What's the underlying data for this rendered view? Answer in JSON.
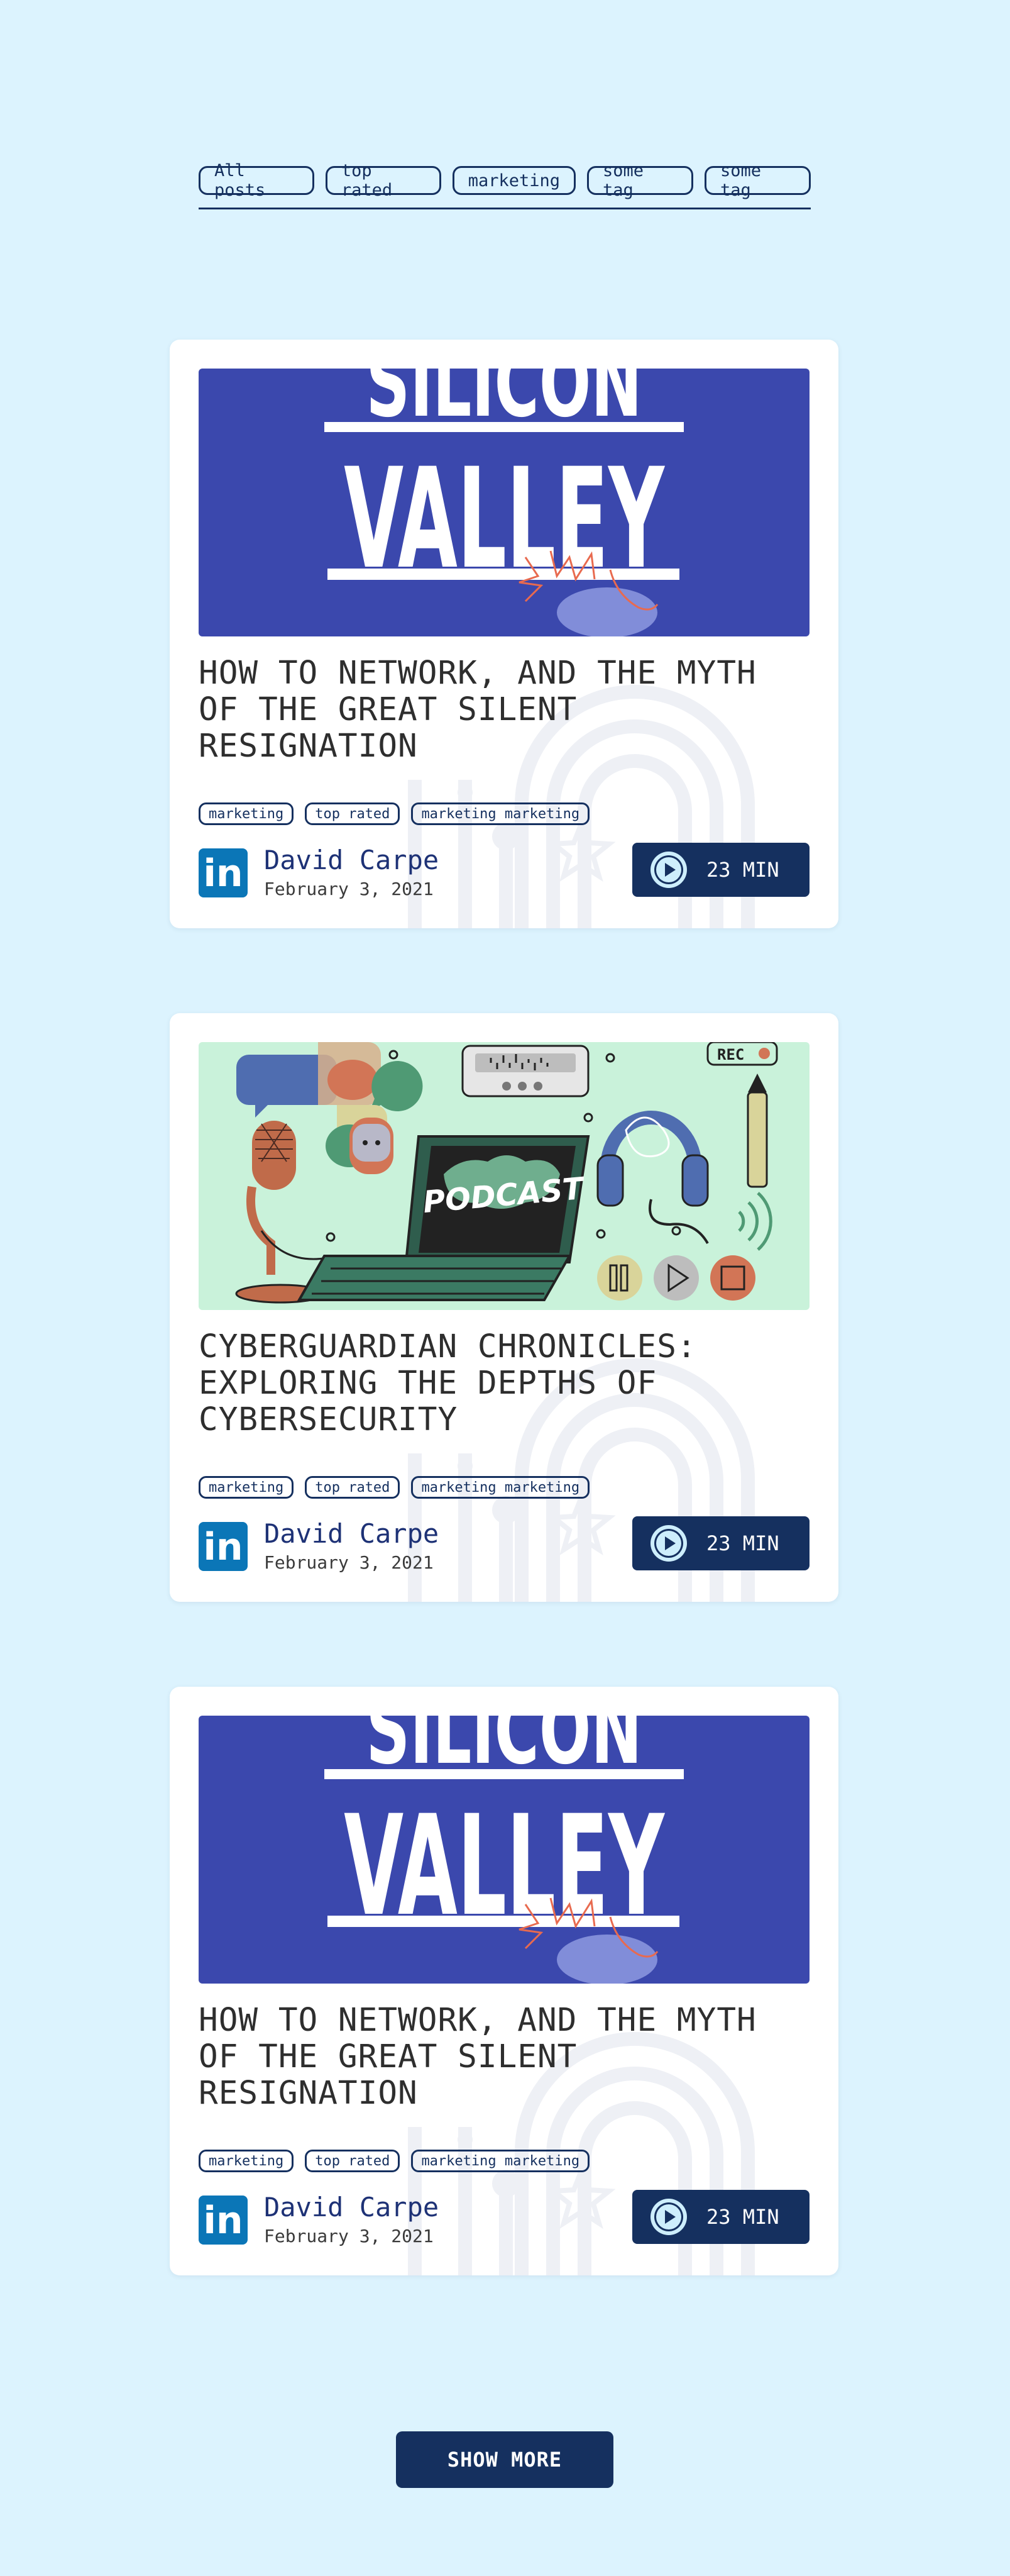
{
  "filters": [
    "All posts",
    "top rated",
    "marketing",
    "some tag",
    "some tag"
  ],
  "colors": {
    "background": "#dcf3fe",
    "navy": "#15305f",
    "author_name": "#1e3276",
    "thumb_blue": "#3b48ad",
    "thumb_mint": "#c9f2da",
    "linkedin": "#0b76b7"
  },
  "posts": [
    {
      "thumbnail": "silicon-valley",
      "thumb_text_top": "SILICON",
      "thumb_text_main": "VALLEY",
      "title": "HOW TO NETWORK, AND THE MYTH OF THE GREAT SILENT RESIGNATION",
      "tags": [
        "marketing",
        "top rated",
        "marketing marketing"
      ],
      "author": "David Carpe",
      "date": "February 3, 2021",
      "duration": "23 MIN",
      "avatar_icon": "linkedin-icon",
      "avatar_text": "in"
    },
    {
      "thumbnail": "podcast",
      "thumb_text_top": "",
      "thumb_text_main": "PODCAST",
      "thumb_rec": "REC",
      "title": "CYBERGUARDIAN CHRONICLES: EXPLORING THE DEPTHS OF CYBERSECURITY",
      "tags": [
        "marketing",
        "top rated",
        "marketing marketing"
      ],
      "author": "David Carpe",
      "date": "February 3, 2021",
      "duration": "23 MIN",
      "avatar_icon": "linkedin-icon",
      "avatar_text": "in"
    },
    {
      "thumbnail": "silicon-valley",
      "thumb_text_top": "SILICON",
      "thumb_text_main": "VALLEY",
      "title": "HOW TO NETWORK, AND THE MYTH OF THE GREAT SILENT RESIGNATION",
      "tags": [
        "marketing",
        "top rated",
        "marketing marketing"
      ],
      "author": "David Carpe",
      "date": "February 3, 2021",
      "duration": "23 MIN",
      "avatar_icon": "linkedin-icon",
      "avatar_text": "in"
    }
  ],
  "show_more": "SHOW MORE"
}
